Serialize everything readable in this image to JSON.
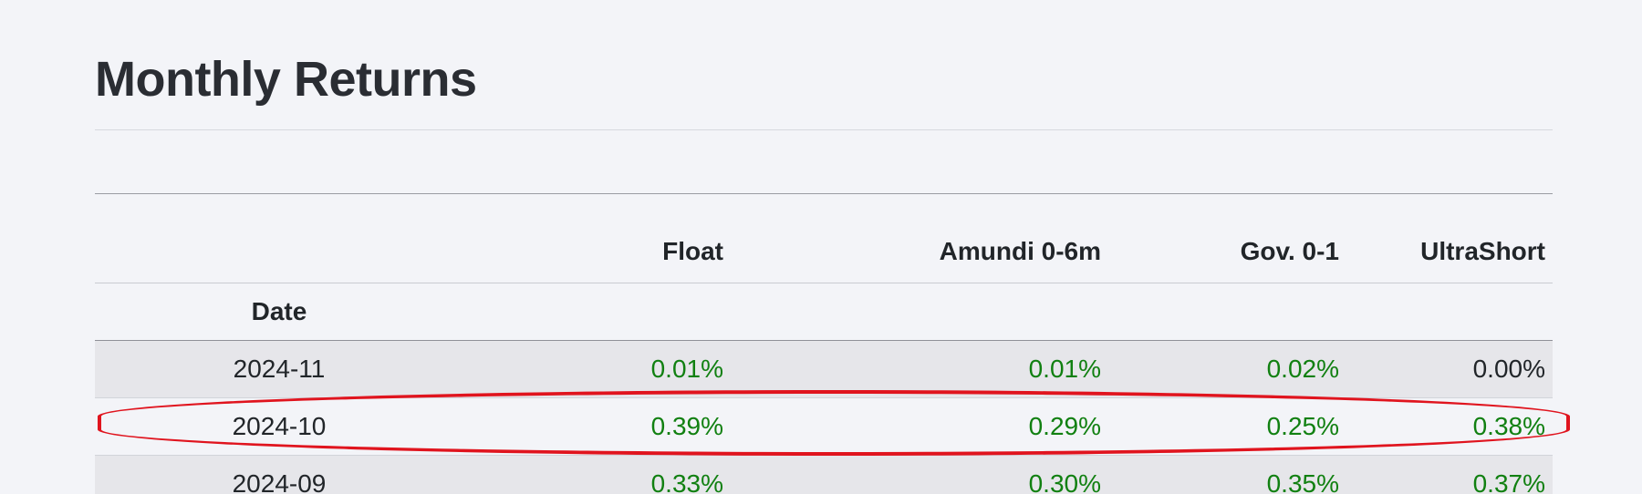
{
  "page": {
    "title": "Monthly Returns"
  },
  "table": {
    "columns": [
      "Float",
      "Amundi 0-6m",
      "Gov. 0-1",
      "UltraShort"
    ],
    "index_name": "Date",
    "rows": [
      {
        "date": "2024-11",
        "values": [
          "0.01%",
          "0.01%",
          "0.02%",
          "0.00%"
        ],
        "signs": [
          "pos",
          "pos",
          "pos",
          "neutral"
        ]
      },
      {
        "date": "2024-10",
        "values": [
          "0.39%",
          "0.29%",
          "0.25%",
          "0.38%"
        ],
        "signs": [
          "pos",
          "pos",
          "pos",
          "pos"
        ]
      },
      {
        "date": "2024-09",
        "values": [
          "0.33%",
          "0.30%",
          "0.35%",
          "0.37%"
        ],
        "signs": [
          "pos",
          "pos",
          "pos",
          "pos"
        ]
      }
    ]
  },
  "colors": {
    "positive": "#118011",
    "neutral": "#212529",
    "highlight": "#e0141e"
  },
  "highlighted_row": "2024-10"
}
